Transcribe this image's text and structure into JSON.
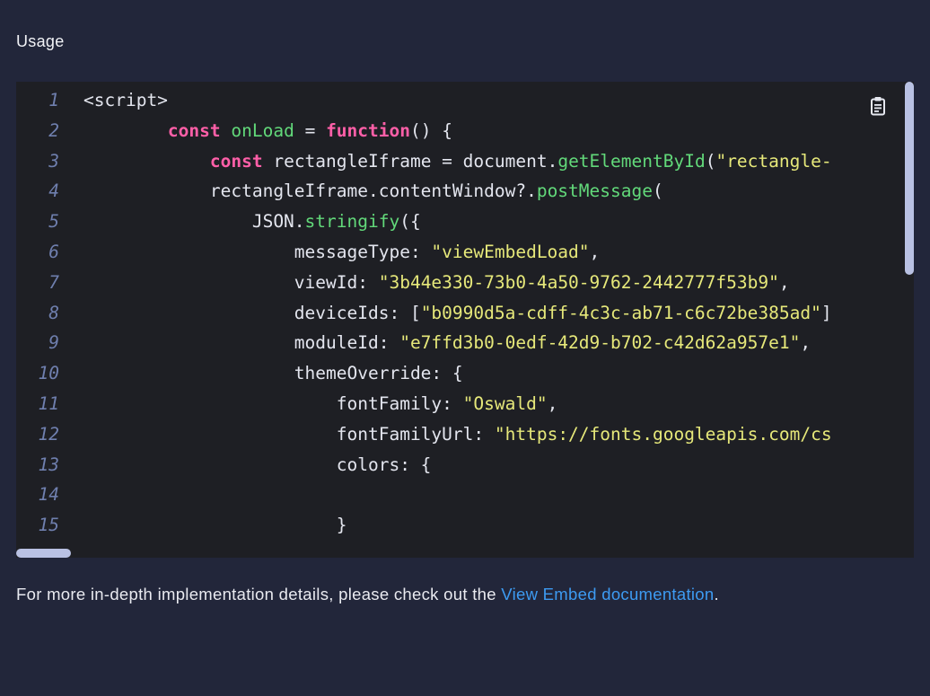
{
  "section": {
    "title": "Usage"
  },
  "code": {
    "lines": [
      {
        "no": "1",
        "tokens": [
          {
            "t": "<script>",
            "c": "plain"
          }
        ]
      },
      {
        "no": "2",
        "tokens": [
          {
            "t": "        ",
            "c": "plain"
          },
          {
            "t": "const",
            "c": "keyword"
          },
          {
            "t": " ",
            "c": "plain"
          },
          {
            "t": "onLoad",
            "c": "fn"
          },
          {
            "t": " = ",
            "c": "plain"
          },
          {
            "t": "function",
            "c": "keyword"
          },
          {
            "t": "() {",
            "c": "plain"
          }
        ]
      },
      {
        "no": "3",
        "tokens": [
          {
            "t": "            ",
            "c": "plain"
          },
          {
            "t": "const",
            "c": "keyword"
          },
          {
            "t": " rectangleIframe = document.",
            "c": "plain"
          },
          {
            "t": "getElementById",
            "c": "fn"
          },
          {
            "t": "(",
            "c": "plain"
          },
          {
            "t": "\"rectangle-",
            "c": "string"
          }
        ]
      },
      {
        "no": "4",
        "tokens": [
          {
            "t": "            rectangleIframe.contentWindow?.",
            "c": "plain"
          },
          {
            "t": "postMessage",
            "c": "fn"
          },
          {
            "t": "(",
            "c": "plain"
          }
        ]
      },
      {
        "no": "5",
        "tokens": [
          {
            "t": "                JSON.",
            "c": "plain"
          },
          {
            "t": "stringify",
            "c": "fn"
          },
          {
            "t": "({",
            "c": "plain"
          }
        ]
      },
      {
        "no": "6",
        "tokens": [
          {
            "t": "                    messageType: ",
            "c": "plain"
          },
          {
            "t": "\"viewEmbedLoad\"",
            "c": "string"
          },
          {
            "t": ",",
            "c": "plain"
          }
        ]
      },
      {
        "no": "7",
        "tokens": [
          {
            "t": "                    viewId: ",
            "c": "plain"
          },
          {
            "t": "\"3b44e330-73b0-4a50-9762-2442777f53b9\"",
            "c": "string"
          },
          {
            "t": ",",
            "c": "plain"
          }
        ]
      },
      {
        "no": "8",
        "tokens": [
          {
            "t": "                    deviceIds: [",
            "c": "plain"
          },
          {
            "t": "\"b0990d5a-cdff-4c3c-ab71-c6c72be385ad\"",
            "c": "string"
          },
          {
            "t": "]",
            "c": "plain"
          }
        ]
      },
      {
        "no": "9",
        "tokens": [
          {
            "t": "                    moduleId: ",
            "c": "plain"
          },
          {
            "t": "\"e7ffd3b0-0edf-42d9-b702-c42d62a957e1\"",
            "c": "string"
          },
          {
            "t": ",",
            "c": "plain"
          }
        ]
      },
      {
        "no": "10",
        "tokens": [
          {
            "t": "                    themeOverride: {",
            "c": "plain"
          }
        ]
      },
      {
        "no": "11",
        "tokens": [
          {
            "t": "                        fontFamily: ",
            "c": "plain"
          },
          {
            "t": "\"Oswald\"",
            "c": "string"
          },
          {
            "t": ",",
            "c": "plain"
          }
        ]
      },
      {
        "no": "12",
        "tokens": [
          {
            "t": "                        fontFamilyUrl: ",
            "c": "plain"
          },
          {
            "t": "\"https://fonts.googleapis.com/cs",
            "c": "string"
          }
        ]
      },
      {
        "no": "13",
        "tokens": [
          {
            "t": "                        colors: {",
            "c": "plain"
          }
        ]
      },
      {
        "no": "14",
        "tokens": []
      },
      {
        "no": "15",
        "tokens": [
          {
            "t": "                        }",
            "c": "plain"
          }
        ]
      }
    ]
  },
  "icons": {
    "copy": "clipboard-icon"
  },
  "footer": {
    "text_before": "For more in-depth implementation details, please check out the ",
    "link_label": "View Embed documentation",
    "text_after": "."
  },
  "colors": {
    "background": "#22263a",
    "code_background": "#1e1f24",
    "keyword": "#ff5fa8",
    "function": "#62d97a",
    "string": "#e6e87a",
    "line_number": "#6f7fae",
    "link": "#3d9bf2",
    "scrollbar_thumb": "#b9c1e3"
  }
}
